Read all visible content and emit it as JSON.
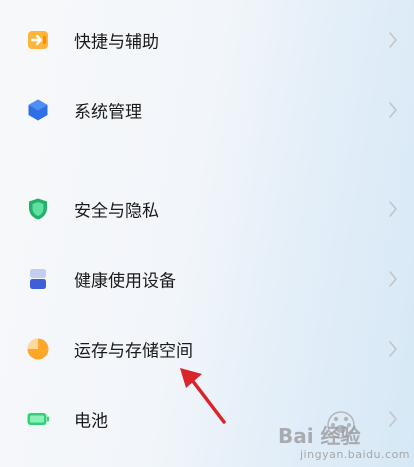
{
  "settings": {
    "items": [
      {
        "label": "快捷与辅助",
        "icon": "accessibility-shortcut-icon",
        "color": "#ff9b1f"
      },
      {
        "label": "系统管理",
        "icon": "system-management-hexagon-icon",
        "color": "#2f6fe6"
      },
      {
        "label": "安全与隐私",
        "icon": "security-shield-icon",
        "color": "#23b06c"
      },
      {
        "label": "健康使用设备",
        "icon": "digital-health-hourglass-icon",
        "color": "#3d5fd8"
      },
      {
        "label": "运存与存储空间",
        "icon": "storage-pie-icon",
        "color": "#ffa726"
      },
      {
        "label": "电池",
        "icon": "battery-icon",
        "color": "#2fd277"
      }
    ]
  },
  "watermark": {
    "brand": "Bai 经验",
    "url": "jingyan.baidu.com"
  },
  "colors": {
    "chevron": "#c4c4c4",
    "annotation_arrow": "#d9242a"
  }
}
